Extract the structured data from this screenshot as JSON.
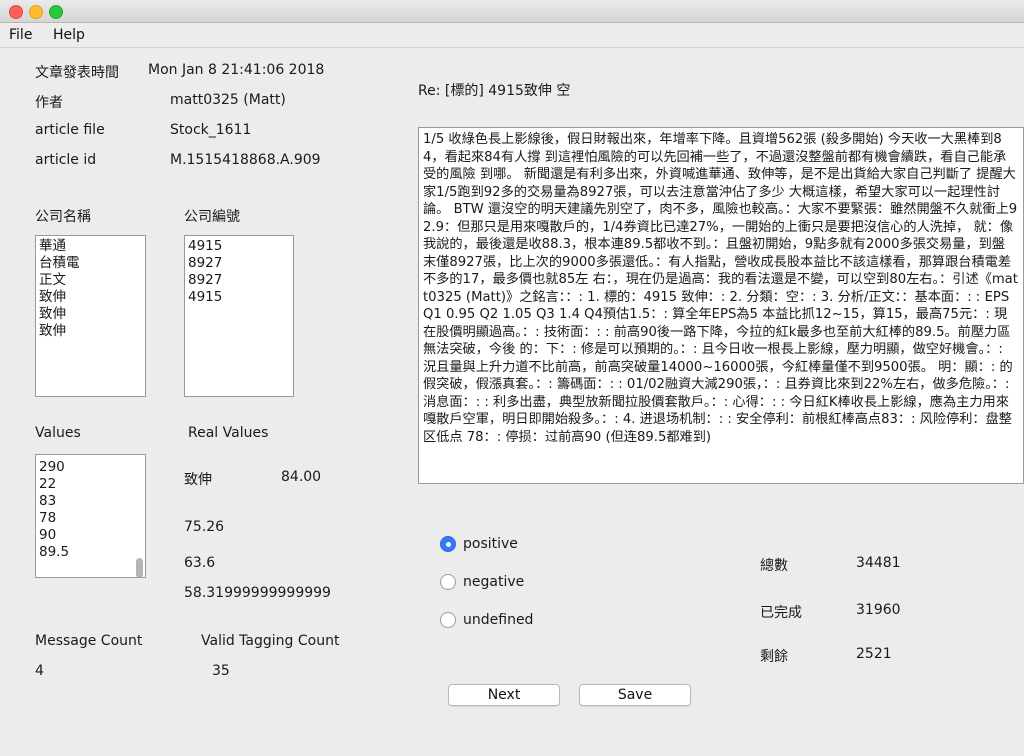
{
  "window": {
    "traffic_lights": {
      "close": "#fc5f57",
      "minimize": "#fdbc2e",
      "zoom": "#28c840"
    }
  },
  "menubar": {
    "items": [
      "File",
      "Help"
    ]
  },
  "meta": {
    "time_label": "文章發表時間",
    "time_value": "Mon Jan  8 21:41:06 2018",
    "author_label": "作者",
    "author_value": "matt0325 (Matt)",
    "file_label": "article file",
    "file_value": "Stock_1611",
    "id_label": "article id",
    "id_value": "M.1515418868.A.909"
  },
  "company": {
    "name_label": "公司名稱",
    "code_label": "公司編號",
    "names": [
      "華通",
      "台積電",
      "正文",
      "致伸",
      "致伸",
      "致伸"
    ],
    "codes": [
      "4915",
      "8927",
      "8927",
      "4915"
    ]
  },
  "values_section": {
    "values_label": "Values",
    "real_values_label": "Real Values",
    "values": [
      "290",
      "22",
      "83",
      "78",
      "90",
      "89.5"
    ],
    "real_company": "致伸",
    "real_values": [
      "84.00",
      "75.26",
      "63.6",
      "58.31999999999999"
    ]
  },
  "counts": {
    "message_label": "Message Count",
    "message_value": "4",
    "valid_label": "Valid Tagging Count",
    "valid_value": "35"
  },
  "article": {
    "title": "Re: [標的] 4915致伸 空",
    "body": "1/5 收綠色長上影線後，假日財報出來，年增率下降。且資增562張 (殺多開始) 今天收一大黑棒到84，看起來84有人撐 到這裡怕風險的可以先回補一些了，不過還沒整盤前都有機會續跌，看自己能承受的風險 到哪。 新聞還是有利多出來，外資喊進華通、致伸等，是不是出貨給大家自己判斷了 提醒大家1/5跑到92多的交易量為8927張，可以去注意當沖佔了多少 大概這樣，希望大家可以一起理性討論。 BTW 還沒空的明天建議先別空了，肉不多，風險也較高。：大家不要緊張：雖然開盤不久就衝上92.9：但那只是用來嘎散戶的，1/4券資比已達27%，一開始的上衝只是要把沒信心的人洗掉， 就：像我說的，最後還是收88.3，根本連89.5都收不到。：且盤初開始，9點多就有2000多張交易量，到盤末僅8927張，比上次的9000多張還低。：有人指點，營收成長股本益比不該這樣看，那算跟台積電差不多的17，最多價也就85左 右：，現在仍是過高：我的看法還是不變，可以空到80左右。：引述《matt0325 (Matt)》之銘言：：: 1. 標的：4915 致伸：: 2. 分類：空：: 3. 分析/正文：：基本面：: : EPS Q1 0.95 Q2 1.05 Q3 1.4 Q4預估1.5：: 算全年EPS為5 本益比抓12~15，算15，最高75元：: 現在股價明顯過高。：: 技術面：: : 前高90後一路下降，今拉的紅k最多也至前大紅棒的89.5。前壓力區無法突破，今後 的：下：: 修是可以預期的。：: 且今日收一根長上影線，壓力明顯，做空好機會。：: 況且量與上升力道不比前高，前高突破量14000~16000張，今紅棒量僅不到9500張。 明：顯：: 的假突破，假漲真套。：: 籌碼面：: : 01/02融資大減290張，：: 且券資比來到22%左右，做多危險。：: 消息面：: : 利多出盡，典型放新聞拉股價套散戶。：: 心得：: : 今日紅K棒收長上影線，應為主力用來嘎散戶空軍，明日即開始殺多。：: 4. 进退场机制：: : 安全停利：前根紅棒高点83：: 风险停利：盘整区低点 78：: 停损：过前高90 (但连89.5都难到)"
  },
  "sentiment": {
    "options": [
      "positive",
      "negative",
      "undefined"
    ],
    "selected": "positive"
  },
  "stats": {
    "total_label": "總數",
    "total_value": "34481",
    "done_label": "已完成",
    "done_value": "31960",
    "remain_label": "剩餘",
    "remain_value": "2521"
  },
  "buttons": {
    "next_label": "Next",
    "save_label": "Save"
  }
}
